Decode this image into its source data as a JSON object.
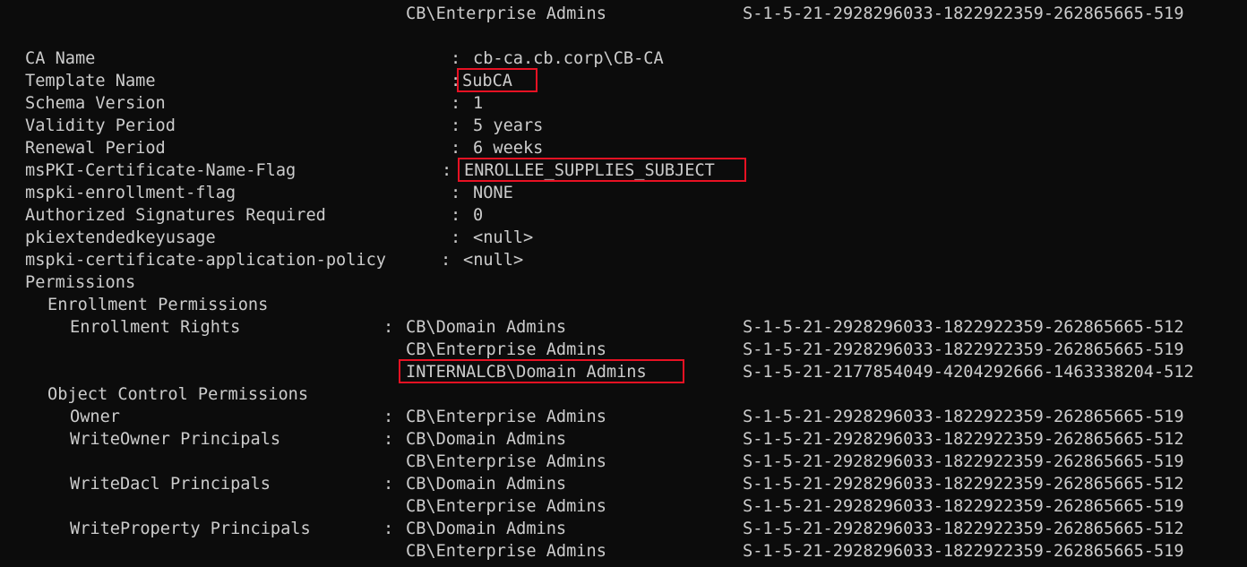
{
  "top_line": {
    "partial": "",
    "principal": "CB\\Enterprise Admins",
    "sid": "S-1-5-21-2928296033-1822922359-262865665-519"
  },
  "properties": [
    {
      "name": "CA Name",
      "value": "cb-ca.cb.corp\\CB-CA"
    },
    {
      "name": "Template Name",
      "value": "SubCA"
    },
    {
      "name": "Schema Version",
      "value": "1"
    },
    {
      "name": "Validity Period",
      "value": "5 years"
    },
    {
      "name": "Renewal Period",
      "value": "6 weeks"
    },
    {
      "name": "msPKI-Certificate-Name-Flag",
      "value": "ENROLLEE_SUPPLIES_SUBJECT"
    },
    {
      "name": "mspki-enrollment-flag",
      "value": "NONE"
    },
    {
      "name": "Authorized Signatures Required",
      "value": "0"
    },
    {
      "name": "pkiextendedkeyusage",
      "value": "<null>"
    },
    {
      "name": "mspki-certificate-application-policy",
      "value": "<null>"
    }
  ],
  "separator": ":",
  "permissions_heading": "Permissions",
  "enrollment_permissions_heading": "Enrollment Permissions",
  "enrollment_rights": {
    "label": "Enrollment Rights",
    "entries": [
      {
        "principal": "CB\\Domain Admins",
        "sid": "S-1-5-21-2928296033-1822922359-262865665-512"
      },
      {
        "principal": "CB\\Enterprise Admins",
        "sid": "S-1-5-21-2928296033-1822922359-262865665-519"
      },
      {
        "principal": "INTERNALCB\\Domain Admins",
        "sid": "S-1-5-21-2177854049-4204292666-1463338204-512"
      }
    ]
  },
  "object_control_heading": "Object Control Permissions",
  "owner": {
    "label": "Owner",
    "entries": [
      {
        "principal": "CB\\Enterprise Admins",
        "sid": "S-1-5-21-2928296033-1822922359-262865665-519"
      }
    ]
  },
  "write_owner": {
    "label": "WriteOwner Principals",
    "entries": [
      {
        "principal": "CB\\Domain Admins",
        "sid": "S-1-5-21-2928296033-1822922359-262865665-512"
      },
      {
        "principal": "CB\\Enterprise Admins",
        "sid": "S-1-5-21-2928296033-1822922359-262865665-519"
      }
    ]
  },
  "write_dacl": {
    "label": "WriteDacl Principals",
    "entries": [
      {
        "principal": "CB\\Domain Admins",
        "sid": "S-1-5-21-2928296033-1822922359-262865665-512"
      },
      {
        "principal": "CB\\Enterprise Admins",
        "sid": "S-1-5-21-2928296033-1822922359-262865665-519"
      }
    ]
  },
  "write_property": {
    "label": "WriteProperty Principals",
    "entries": [
      {
        "principal": "CB\\Domain Admins",
        "sid": "S-1-5-21-2928296033-1822922359-262865665-512"
      },
      {
        "principal": "CB\\Enterprise Admins",
        "sid": "S-1-5-21-2928296033-1822922359-262865665-519"
      }
    ]
  },
  "colors": {
    "background": "#0c0c0c",
    "text": "#cccccc",
    "highlight_box": "#e81123"
  }
}
